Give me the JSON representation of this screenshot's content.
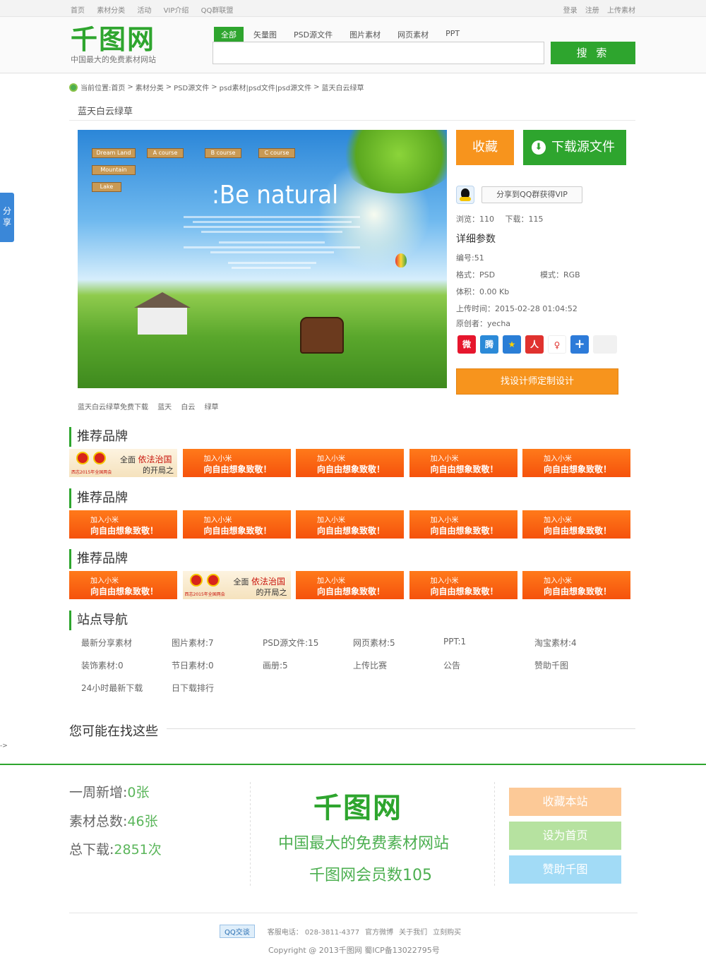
{
  "topbar": {
    "nav": [
      "首页",
      "素材分类",
      "活动",
      "VIP介绍",
      "QQ群联盟"
    ],
    "links": [
      "登录",
      "注册",
      "上传素材"
    ]
  },
  "header": {
    "logo_text": "千图网",
    "slogan": "中国最大的免费素材网站",
    "search_tabs": [
      "全部",
      "矢量图",
      "PSD源文件",
      "图片素材",
      "网页素材",
      "PPT"
    ],
    "search_value": "",
    "search_button": "搜 索"
  },
  "breadcrumb": {
    "label": "当前位置:",
    "items": [
      "首页",
      "素材分类",
      "PSD源文件",
      "psd素材|psd文件|psd源文件",
      "蓝天白云绿草"
    ]
  },
  "page_title": "蓝天白云绿草",
  "preview": {
    "headline": ":Be natural",
    "signs": [
      "Dream Land",
      "A course",
      "B course",
      "C course",
      "Mountain",
      "Lake"
    ]
  },
  "actions": {
    "favorite": "收藏",
    "download": "下载源文件",
    "share_vip": "分享到QQ群获得VIP"
  },
  "stats": {
    "views_label": "浏览：110",
    "downloads_label": "下载：115"
  },
  "details": {
    "title": "详细参数",
    "id": "编号:51",
    "format": "格式：PSD",
    "mode": "模式：RGB",
    "size": "体积：0.00 Kb",
    "upload_time": "上传时间：2015-02-28 01:04:52",
    "author": "原创者：yecha"
  },
  "custom_design_button": "找设计师定制设计",
  "tags": [
    "蓝天白云绿草免费下载",
    "蓝天",
    "白云",
    "绿草"
  ],
  "brand_sections": [
    {
      "title": "推荐品牌"
    },
    {
      "title": "推荐品牌"
    },
    {
      "title": "推荐品牌"
    }
  ],
  "ads": {
    "orange_line1": "加入小米",
    "orange_line2": "向自由想象致敬！",
    "gov_line1a": "全面",
    "gov_line1b": "依法治国",
    "gov_line2": "的开局之",
    "gov_line3": "西志2015年全国两会"
  },
  "site_nav": {
    "title": "站点导航",
    "items": [
      "最新分享素材",
      "图片素材:7",
      "PSD源文件:15",
      "网页素材:5",
      "PPT:1",
      "淘宝素材:4",
      "装饰素材:0",
      "节日素材:0",
      "画册:5",
      "上传比赛",
      "公告",
      "赞助千图",
      "24小时最新下载",
      "日下载排行"
    ]
  },
  "maybe_looking": "您可能在找这些",
  "stray_text": "->",
  "footer": {
    "weekly_label": "一周新增:",
    "weekly_value": "0张",
    "total_label": "素材总数:",
    "total_value": "46张",
    "downloads_label": "总下载:",
    "downloads_value": "2851次",
    "logo_text": "千图网",
    "slogan": "中国最大的免费素材网站",
    "members": "千图网会员数105",
    "buttons": [
      "收藏本站",
      "设为首页",
      "赞助千图"
    ],
    "qq_chat": "QQ交谈",
    "phone": "客服电话： 028-3811-4377",
    "weibo": "官方微博",
    "about": "关于我们",
    "buy": "立刻购买",
    "copyright": "Copyright @ 2013千图网 蜀ICP备13022795号"
  },
  "share_tab": "分享",
  "colors": {
    "brand_green": "#2ea52e",
    "orange": "#f7941d",
    "footer_orange": "#fcc997",
    "footer_green": "#b6e2a0",
    "footer_blue": "#a2dbf6"
  }
}
